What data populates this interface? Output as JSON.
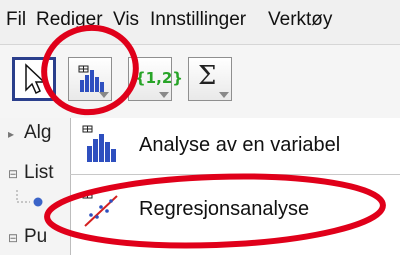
{
  "menubar": {
    "items": [
      "Fil",
      "Rediger",
      "Vis",
      "Innstillinger",
      "Verktøy"
    ]
  },
  "toolbar": {
    "move_tool": {
      "icon": "pointer-arrow-icon"
    },
    "analysis_tool": {
      "icon": "bar-chart-icon"
    },
    "list_tool": {
      "icon": "list-icon",
      "text": "{1,2}"
    },
    "sum_tool": {
      "icon": "sigma-icon",
      "text": "Σ"
    }
  },
  "left_panel": {
    "rows": [
      "Alg",
      "List",
      "Pu"
    ]
  },
  "dropdown": {
    "items": [
      {
        "label": "Analyse av en variabel",
        "icon": "bar-chart-icon"
      },
      {
        "label": "Regresjonsanalyse",
        "icon": "scatter-regression-icon"
      }
    ]
  },
  "colors": {
    "annotation_red": "#e0001a",
    "list_green": "#28a428",
    "bar_blue": "#2e4fbf"
  }
}
